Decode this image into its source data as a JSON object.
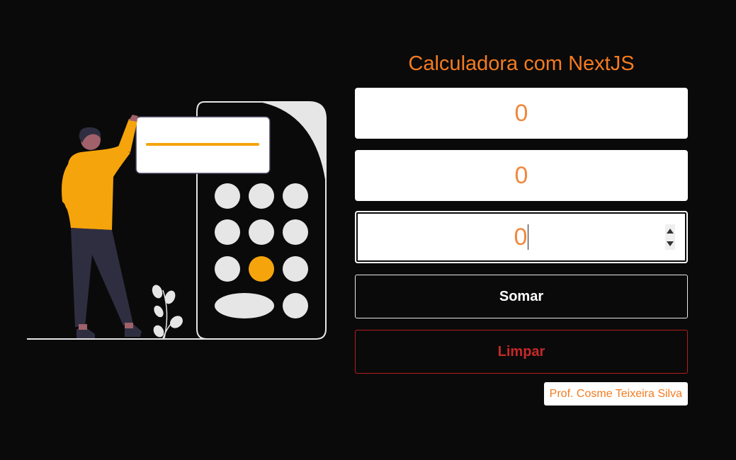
{
  "app": {
    "title": "Calculadora com NextJS"
  },
  "inputs": [
    {
      "value": "0"
    },
    {
      "value": "0"
    },
    {
      "value": "0"
    }
  ],
  "buttons": {
    "sum_label": "Somar",
    "clear_label": "Limpar"
  },
  "footer": {
    "credit": "Prof. Cosme Teixeira Silva"
  },
  "colors": {
    "background": "#0a0a0a",
    "accent": "#f47b20",
    "input_text": "#f0883e",
    "danger": "#c62828",
    "figure_shirt": "#f5a40c"
  },
  "icons": {
    "spinner_up": "triangle-up",
    "spinner_down": "triangle-down"
  }
}
